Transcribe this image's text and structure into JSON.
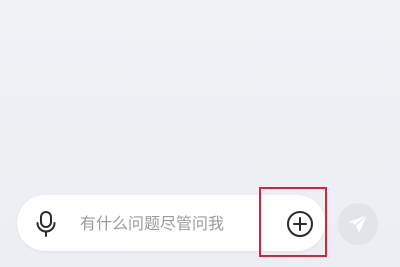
{
  "input": {
    "placeholder": "有什么问题尽管问我",
    "value": ""
  },
  "icons": {
    "mic": "microphone-icon",
    "plus": "plus-circle-icon",
    "send": "send-icon"
  },
  "colors": {
    "background": "#eef0f5",
    "input_bar": "#ffffff",
    "highlight": "#d8223a",
    "send_disabled": "#e2e4e9"
  }
}
